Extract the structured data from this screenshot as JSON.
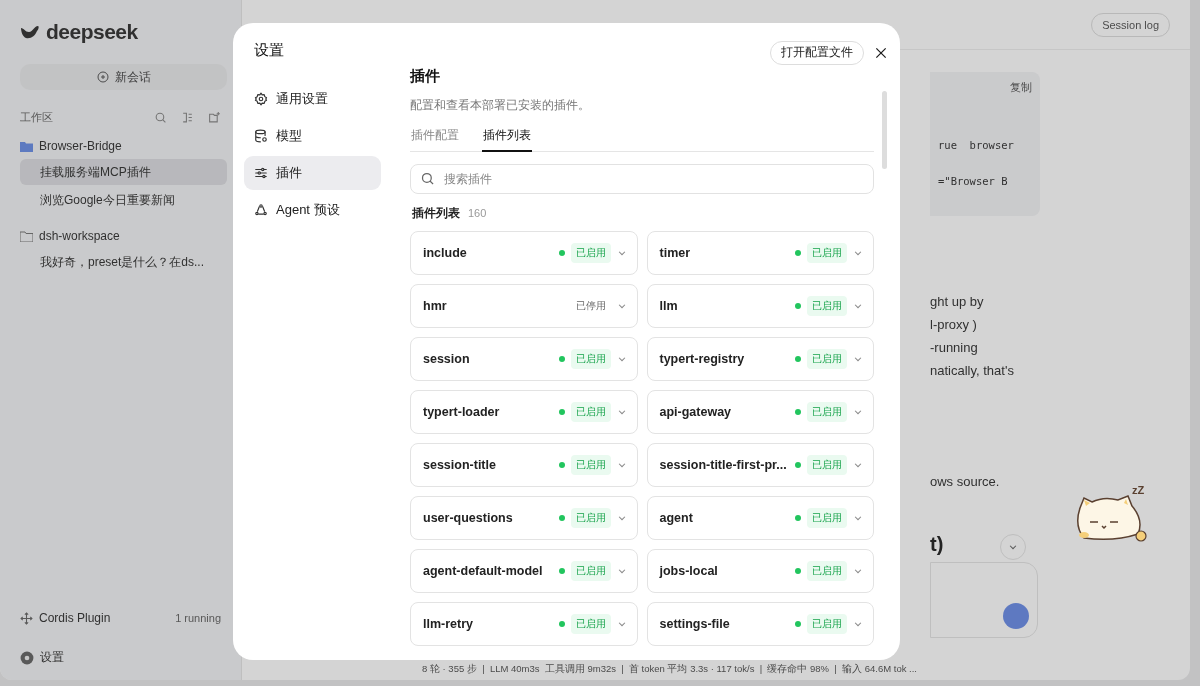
{
  "sidebar": {
    "logo": "deepseek",
    "new_chat": "新会话",
    "workspace_label": "工作区",
    "groups": [
      {
        "name": "Browser-Bridge",
        "kind": "project",
        "children": [
          {
            "title": "挂载服务端MCP插件",
            "selected": true
          },
          {
            "title": "浏览Google今日重要新闻",
            "selected": false
          }
        ]
      },
      {
        "name": "dsh-workspace",
        "kind": "folder",
        "children": [
          {
            "title": "我好奇，preset是什么？在ds...",
            "selected": false
          }
        ]
      }
    ],
    "plugin_status": {
      "name": "Cordis Plugin",
      "count": "1 running"
    },
    "settings": "设置"
  },
  "main": {
    "session_log": "Session log",
    "copy": "复制",
    "code_lines": [
      "rue  browser",
      "=\"Browser B"
    ],
    "text_lines": [
      "ght up by",
      "l-proxy )",
      "-running",
      "natically, that's"
    ],
    "text_tail": "ows source.",
    "heading_tail": "t)",
    "sticker": {
      "kind": "picture",
      "sleep_mark": "zZ"
    },
    "status_bar": "8 轮 · 355 步  |  LLM 40m3s  工具调用 9m32s  |  首 token 平均 3.3s · 117 tok/s  |  缓存命中 98%  |  输入 64.6M tok ..."
  },
  "dialog": {
    "title": "设置",
    "open_config": "打开配置文件",
    "nav": [
      {
        "label": "通用设置",
        "selected": false
      },
      {
        "label": "模型",
        "selected": false
      },
      {
        "label": "插件",
        "selected": true
      },
      {
        "label": "Agent 预设",
        "selected": false
      }
    ],
    "heading": "插件",
    "description": "配置和查看本部署已安装的插件。",
    "tabs": [
      {
        "label": "插件配置",
        "selected": false
      },
      {
        "label": "插件列表",
        "selected": true
      }
    ],
    "search": {
      "placeholder": "搜索插件"
    },
    "list_title": "插件列表",
    "list_count": "160",
    "plugins": [
      {
        "name": "include",
        "status": "已启用",
        "enabled": true
      },
      {
        "name": "timer",
        "status": "已启用",
        "enabled": true
      },
      {
        "name": "hmr",
        "status": "已停用",
        "enabled": false
      },
      {
        "name": "llm",
        "status": "已启用",
        "enabled": true
      },
      {
        "name": "session",
        "status": "已启用",
        "enabled": true
      },
      {
        "name": "typert-registry",
        "status": "已启用",
        "enabled": true
      },
      {
        "name": "typert-loader",
        "status": "已启用",
        "enabled": true
      },
      {
        "name": "api-gateway",
        "status": "已启用",
        "enabled": true
      },
      {
        "name": "session-title",
        "status": "已启用",
        "enabled": true
      },
      {
        "name": "session-title-first-pr...",
        "status": "已启用",
        "enabled": true
      },
      {
        "name": "user-questions",
        "status": "已启用",
        "enabled": true
      },
      {
        "name": "agent",
        "status": "已启用",
        "enabled": true
      },
      {
        "name": "agent-default-model",
        "status": "已启用",
        "enabled": true
      },
      {
        "name": "jobs-local",
        "status": "已启用",
        "enabled": true
      },
      {
        "name": "llm-retry",
        "status": "已启用",
        "enabled": true
      },
      {
        "name": "settings-file",
        "status": "已启用",
        "enabled": true
      }
    ]
  }
}
